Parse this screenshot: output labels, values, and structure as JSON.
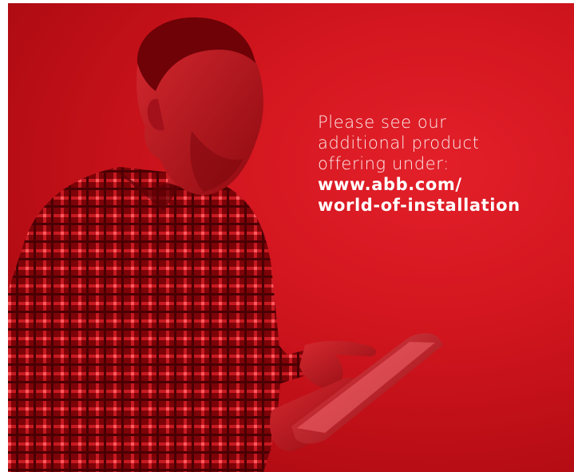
{
  "colors": {
    "brand_red": "#d3161f",
    "text": "#ffffff"
  },
  "caption": {
    "line1": "Please see our",
    "line2": "additional product",
    "line3": "offering under:",
    "link_line1": "www.abb.com/",
    "link_line2": "world-of-installation"
  },
  "image": {
    "icon": "man-using-tablet-photo"
  }
}
